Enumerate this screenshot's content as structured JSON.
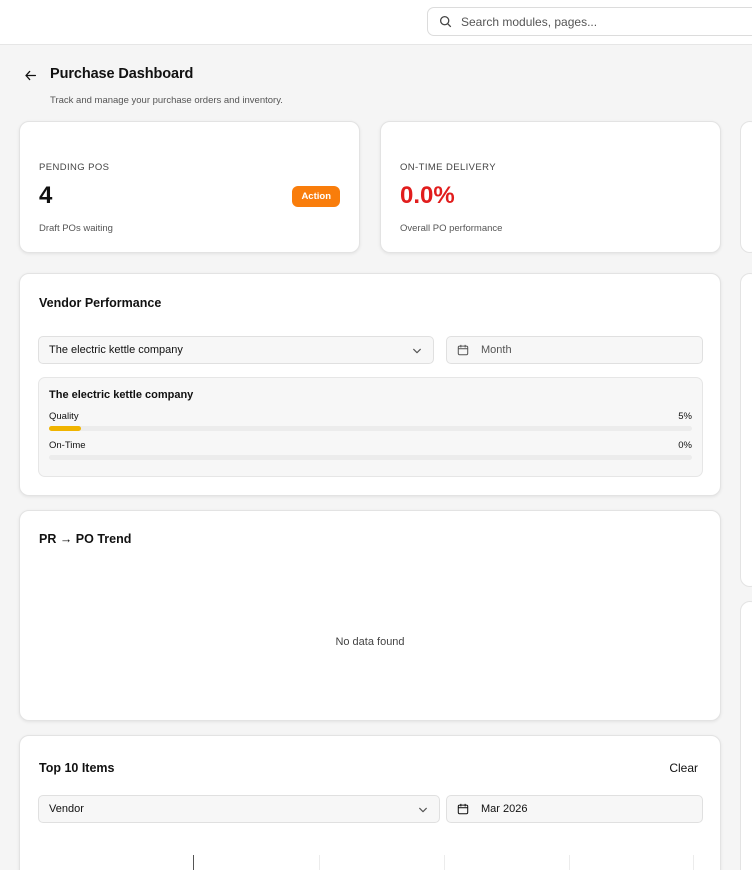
{
  "search": {
    "placeholder": "Search modules, pages..."
  },
  "header": {
    "title": "Purchase Dashboard",
    "subtitle": "Track and manage your purchase orders and inventory."
  },
  "pending_pos": {
    "label": "PENDING POS",
    "value": "4",
    "badge": "Action",
    "description": "Draft POs waiting"
  },
  "on_time_delivery": {
    "label": "ON-TIME DELIVERY",
    "value": "0.0%",
    "description": "Overall PO performance"
  },
  "vendor_performance": {
    "title": "Vendor Performance",
    "vendor_select": "The electric kettle company",
    "period_placeholder": "Month",
    "vendor_name": "The electric kettle company",
    "metrics": [
      {
        "label": "Quality",
        "value": "5%",
        "fraction": 0.05
      },
      {
        "label": "On-Time",
        "value": "0%",
        "fraction": 0.0
      }
    ]
  },
  "pr_po_trend": {
    "title": "PR → PO Trend",
    "empty_text": "No data found"
  },
  "top_items": {
    "title": "Top 10 Items",
    "clear_label": "Clear",
    "vendor_select": "Vendor",
    "date_value": "Mar 2026"
  },
  "colors": {
    "accent_orange": "#f97d0b",
    "danger_red": "#e11d1d",
    "quality_bar": "#f0b400"
  },
  "icons": {
    "search": "search-icon",
    "back": "arrow-left-icon",
    "chevron": "chevron-down-icon",
    "calendar": "calendar-icon"
  }
}
